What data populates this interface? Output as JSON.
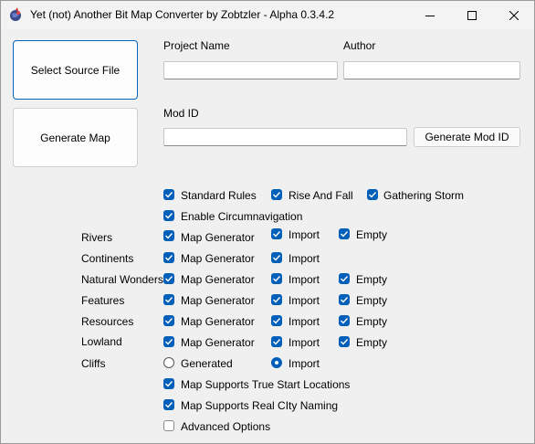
{
  "window": {
    "title": "Yet (not) Another Bit Map Converter by Zobtzler - Alpha 0.3.4.2"
  },
  "buttons": {
    "select_source": "Select Source File",
    "generate_map": "Generate Map",
    "generate_mod_id": "Generate Mod ID"
  },
  "fields": {
    "project_name_label": "Project Name",
    "project_name_value": "",
    "author_label": "Author",
    "author_value": "",
    "mod_id_label": "Mod ID",
    "mod_id_value": ""
  },
  "rules": {
    "standard": "Standard Rules",
    "rise_fall": "Rise And Fall",
    "gathering_storm": "Gathering Storm",
    "circumnavigation": "Enable Circumnavigation"
  },
  "rows": {
    "rivers": {
      "label": "Rivers",
      "gen": "Map Generator",
      "imp": "Import",
      "empty": "Empty"
    },
    "continents": {
      "label": "Continents",
      "gen": "Map Generator",
      "imp": "Import"
    },
    "natural_wonders": {
      "label": "Natural Wonders",
      "gen": "Map Generator",
      "imp": "Import",
      "empty": "Empty"
    },
    "features": {
      "label": "Features",
      "gen": "Map Generator",
      "imp": "Import",
      "empty": "Empty"
    },
    "resources": {
      "label": "Resources",
      "gen": "Map Generator",
      "imp": "Import",
      "empty": "Empty"
    },
    "lowland": {
      "label": "Lowland",
      "gen": "Map Generator",
      "imp": "Import",
      "empty": "Empty"
    },
    "cliffs": {
      "label": "Cliffs",
      "generated": "Generated",
      "imp": "Import"
    }
  },
  "options": {
    "true_start": "Map Supports True Start Locations",
    "real_city": "Map Supports Real CIty Naming",
    "advanced": "Advanced Options"
  },
  "colors": {
    "accent": "#005fb8",
    "focus_border": "#0067c0"
  }
}
